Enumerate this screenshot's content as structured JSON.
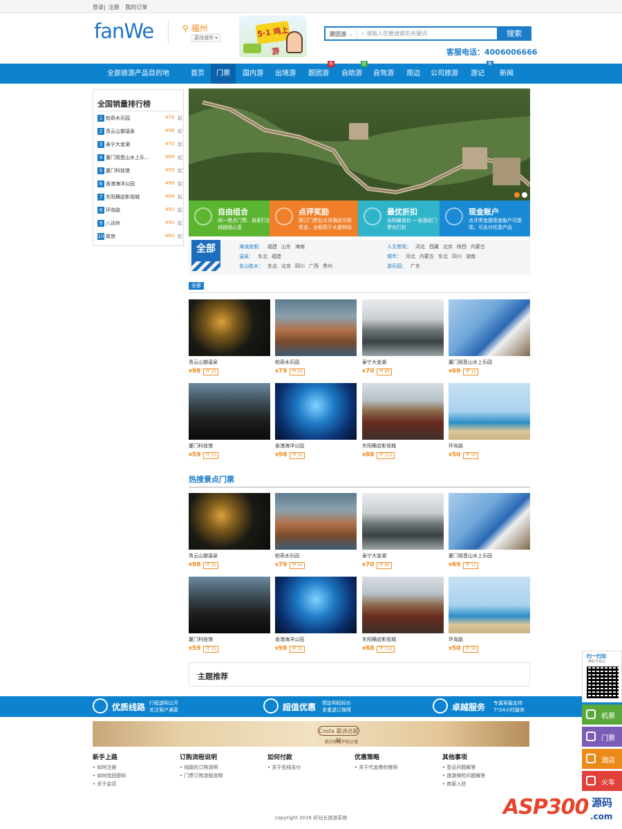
{
  "topbar": {
    "login": "登录",
    "sep": "|",
    "register": "注册",
    "orders": "我的订单"
  },
  "header": {
    "logo": "fanWe",
    "city": "福州",
    "city_switch": "更改城市",
    "promo_text": "5·1 鸡上游",
    "search": {
      "category": "跟团游",
      "placeholder": "请输入您要搜索的关键词",
      "button": "搜索"
    },
    "hotline": "客服电话：4006006666"
  },
  "nav": {
    "all_label": "全部旅游产品目的地",
    "items": [
      {
        "label": "首页",
        "tag": ""
      },
      {
        "label": "门票",
        "tag": ""
      },
      {
        "label": "国内游",
        "tag": ""
      },
      {
        "label": "出境游",
        "tag": ""
      },
      {
        "label": "跟团游",
        "tag": "热"
      },
      {
        "label": "自助游",
        "tag": "促"
      },
      {
        "label": "自驾游",
        "tag": ""
      },
      {
        "label": "周边",
        "tag": ""
      },
      {
        "label": "公司旅游",
        "tag": ""
      },
      {
        "label": "游记",
        "tag": "新"
      },
      {
        "label": "新闻",
        "tag": ""
      }
    ],
    "tag_colors": {
      "热": "#d6262d",
      "促": "#3aa64b",
      "新": "#1b7cc8"
    }
  },
  "ranking": {
    "title": "全国销量排行榜",
    "items": [
      {
        "num": "1",
        "name": "帕奇水乐园",
        "price": "¥79",
        "suffix": "起"
      },
      {
        "num": "2",
        "name": "青云山御温泉",
        "price": "¥98",
        "suffix": "起"
      },
      {
        "num": "3",
        "name": "泰宁大金湖",
        "price": "¥70",
        "suffix": "起"
      },
      {
        "num": "4",
        "name": "厦门观音山水上乐...",
        "price": "¥69",
        "suffix": "起"
      },
      {
        "num": "5",
        "name": "厦门科技馆",
        "price": "¥59",
        "suffix": "起"
      },
      {
        "num": "6",
        "name": "香港海洋公园",
        "price": "¥98",
        "suffix": "起"
      },
      {
        "num": "7",
        "name": "东阳横店影视城",
        "price": "¥88",
        "suffix": "起"
      },
      {
        "num": "8",
        "name": "环岛路",
        "price": "¥50",
        "suffix": "起"
      },
      {
        "num": "9",
        "name": "八达岭",
        "price": "¥50",
        "suffix": "起"
      },
      {
        "num": "10",
        "name": "故宫",
        "price": "¥60",
        "suffix": "起"
      }
    ]
  },
  "features": [
    {
      "title": "自由组合",
      "sub": "同一景点门票、自家打包线路随心意",
      "color": "#5cb531"
    },
    {
      "title": "点评奖励",
      "sub": "预订门票后点评酒店可获奖金，全额高于太爱网站",
      "color": "#f07f2a"
    },
    {
      "title": "最优折扣",
      "sub": "全网最低价 一张酒店门票也打折",
      "color": "#2fb4c9"
    },
    {
      "title": "现金账户",
      "sub": "点评奖金提现金账户可提现，可支付任意产品",
      "color": "#1a8ad4"
    }
  ],
  "filter": {
    "all": "全部",
    "rows_left": [
      {
        "label": "海滨度假：",
        "values": [
          "福建",
          "山东",
          "海南"
        ]
      },
      {
        "label": "温泉：",
        "values": [
          "东北",
          "福建"
        ]
      },
      {
        "label": "名山胜水：",
        "values": [
          "东北",
          "北京",
          "四川",
          "广西",
          "贵州"
        ]
      }
    ],
    "rows_right": [
      {
        "label": "人文景观：",
        "values": [
          "河北",
          "西藏",
          "北京",
          "陕西",
          "内蒙古"
        ]
      },
      {
        "label": "城市：",
        "values": [
          "河北",
          "内蒙古",
          "东北",
          "四川",
          "湖南"
        ]
      },
      {
        "label": "游乐园：",
        "values": [
          "广东"
        ]
      }
    ]
  },
  "all_badge": "全部",
  "tickets": [
    {
      "name": "青云山御温泉",
      "price": "98",
      "rate": "25",
      "img": "night"
    },
    {
      "name": "帕奇水乐园",
      "price": "79",
      "rate": "41",
      "img": "ship"
    },
    {
      "name": "泰宁大金湖",
      "price": "70",
      "rate": "80",
      "img": "lake"
    },
    {
      "name": "厦门观音山水上乐园",
      "price": "69",
      "rate": "11",
      "img": "slide"
    },
    {
      "name": "厦门科技馆",
      "price": "59",
      "rate": "21",
      "img": "dino"
    },
    {
      "name": "香港海洋公园",
      "price": "98",
      "rate": "32",
      "img": "aqua"
    },
    {
      "name": "东阳横店影视城",
      "price": "88",
      "rate": "112",
      "img": "studio"
    },
    {
      "name": "环岛路",
      "price": "50",
      "rate": "50",
      "img": "beach"
    }
  ],
  "price_prefix": "¥",
  "rate_prefix": "评",
  "hot_title": "热搜景点门票",
  "theme_title": "主题推荐",
  "services": [
    {
      "title": "优质线路",
      "sub1": "行程透明公开",
      "sub2": "关注客户满意"
    },
    {
      "title": "超值优惠",
      "sub1": "预定明码标价",
      "sub2": "多重透订保障"
    },
    {
      "title": "卓越服务",
      "sub1": "专属客服支持",
      "sub2": "7*24小时服务"
    }
  ],
  "ad": {
    "brand": "Costa 歌诗达邮轮",
    "sub": "航向你所不知之境"
  },
  "footer": [
    {
      "head": "新手上路",
      "links": [
        "如何注册",
        "如何找回密码",
        "关于会员"
      ]
    },
    {
      "head": "订购流程说明",
      "links": [
        "线路的订购说明",
        "门票订购流程说明"
      ]
    },
    {
      "head": "如何付款",
      "links": [
        "关于在线支付"
      ]
    },
    {
      "head": "优惠策略",
      "links": [
        "关于代金券的使用"
      ]
    },
    {
      "head": "其他事项",
      "links": [
        "签证问题解答",
        "旅游保险问题解答",
        "商家入驻"
      ]
    }
  ],
  "copyright": "copyright 2016 好站长旅游系统",
  "float": {
    "qr_title": "扫一扫加",
    "qr_sub": "精彩不错过",
    "buttons": [
      {
        "label": "机票",
        "color": "#5aa83a"
      },
      {
        "label": "门票",
        "color": "#7b5db8"
      },
      {
        "label": "酒店",
        "color": "#ea8a1a"
      },
      {
        "label": "火车",
        "color": "#e0413a"
      }
    ]
  },
  "watermark": {
    "a": "ASP300",
    "b": "源码",
    "c": ".com"
  }
}
